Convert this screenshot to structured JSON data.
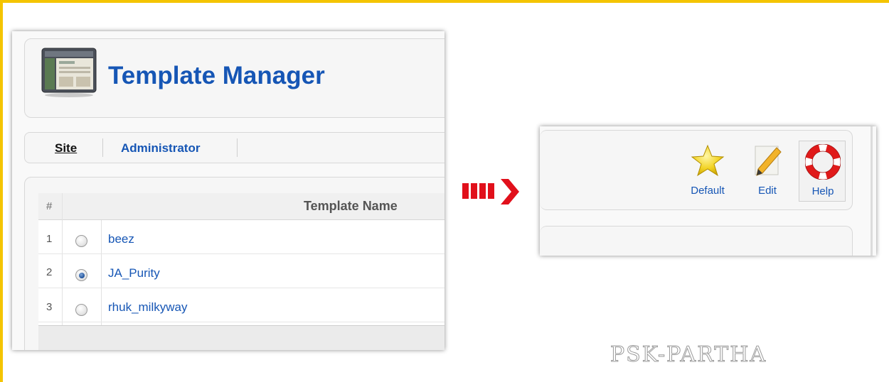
{
  "colors": {
    "frame": "#f4c400",
    "link_blue": "#1656b5",
    "arrow_red": "#e1101b"
  },
  "left_panel": {
    "title": "Template Manager",
    "icon": "template-manager-icon",
    "tabs": [
      {
        "label": "Site",
        "active": true
      },
      {
        "label": "Administrator",
        "active": false
      }
    ],
    "table": {
      "columns": [
        "#",
        "Template Name"
      ],
      "rows": [
        {
          "num": "1",
          "name": "beez",
          "selected": false
        },
        {
          "num": "2",
          "name": "JA_Purity",
          "selected": true
        },
        {
          "num": "3",
          "name": "rhuk_milkyway",
          "selected": false
        }
      ]
    }
  },
  "arrow": {
    "icon": "right-arrow-icon"
  },
  "right_panel": {
    "toolbar": [
      {
        "label": "Default",
        "icon": "star-icon"
      },
      {
        "label": "Edit",
        "icon": "pencil-icon"
      },
      {
        "label": "Help",
        "icon": "lifebuoy-icon"
      }
    ]
  },
  "watermark": "PSK-PARTHA"
}
